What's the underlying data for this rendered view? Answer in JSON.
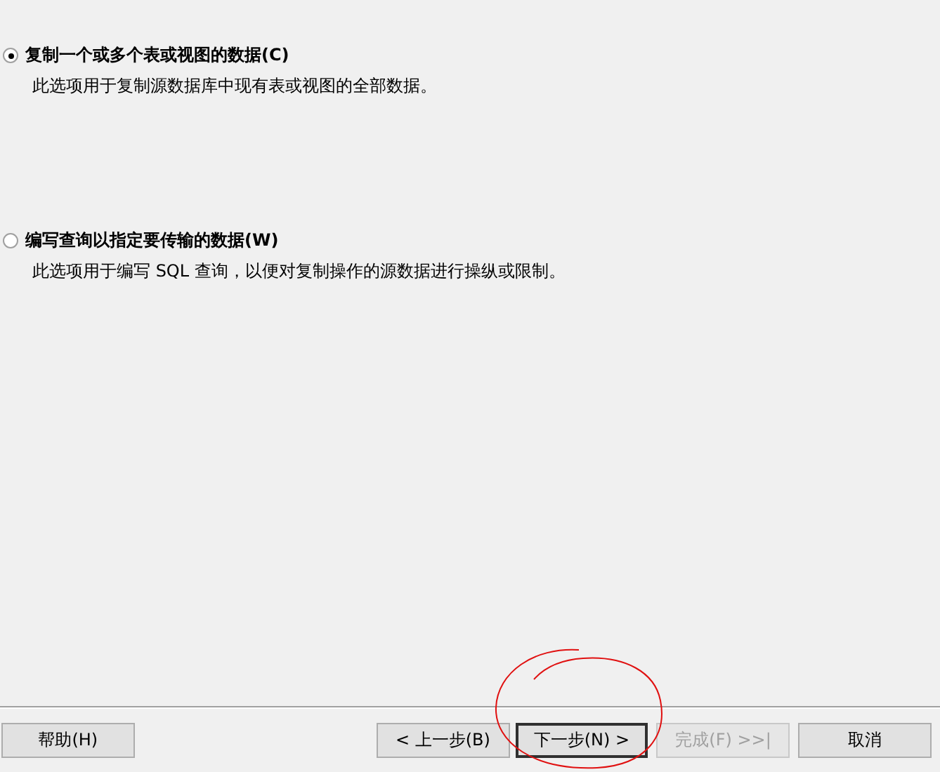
{
  "options": [
    {
      "label": "复制一个或多个表或视图的数据(C)",
      "description": "此选项用于复制源数据库中现有表或视图的全部数据。",
      "selected": true
    },
    {
      "label": "编写查询以指定要传输的数据(W)",
      "description": "此选项用于编写 SQL 查询，以便对复制操作的源数据进行操纵或限制。",
      "selected": false
    }
  ],
  "buttons": [
    {
      "label": "帮助(H)",
      "kind": "help",
      "disabled": false,
      "default": false
    },
    {
      "label": "< 上一步(B)",
      "kind": "nav",
      "disabled": false,
      "default": false
    },
    {
      "label": "下一步(N) >",
      "kind": "nav",
      "disabled": false,
      "default": true
    },
    {
      "label": "完成(F) >>|",
      "kind": "nav",
      "disabled": true,
      "default": false
    },
    {
      "label": "取消",
      "kind": "cancel",
      "disabled": false,
      "default": false
    }
  ]
}
